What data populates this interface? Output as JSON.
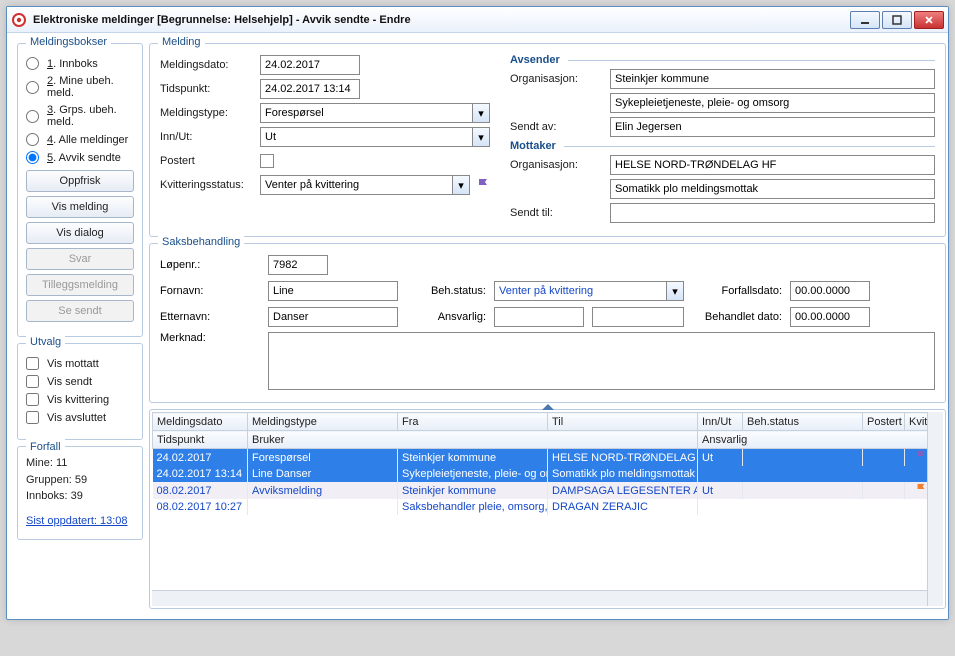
{
  "window": {
    "title": "Elektroniske meldinger  [Begrunnelse: Helsehjelp] - Avvik sendte - Endre"
  },
  "mailboxes": {
    "legend": "Meldingsbokser",
    "items": [
      {
        "num": "1",
        "label": "Innboks"
      },
      {
        "num": "2",
        "label": "Mine ubeh. meld."
      },
      {
        "num": "3",
        "label": "Grps. ubeh. meld."
      },
      {
        "num": "4",
        "label": "Alle meldinger"
      },
      {
        "num": "5",
        "label": "Avvik sendte"
      }
    ]
  },
  "buttons": {
    "oppfrisk": "Oppfrisk",
    "vis_melding": "Vis melding",
    "vis_dialog": "Vis dialog",
    "svar": "Svar",
    "tilleggsmelding": "Tilleggsmelding",
    "se_sendt": "Se sendt"
  },
  "utvalg": {
    "legend": "Utvalg",
    "vis_mottatt": "Vis mottatt",
    "vis_sendt": "Vis sendt",
    "vis_kvittering": "Vis kvittering",
    "vis_avsluttet": "Vis avsluttet"
  },
  "forfall": {
    "legend": "Forfall",
    "mine": "Mine: 11",
    "gruppen": "Gruppen: 59",
    "innboks": "Innboks: 39",
    "sist_oppdatert": "Sist oppdatert: 13:08"
  },
  "melding": {
    "legend": "Melding",
    "labels": {
      "meldingsdato": "Meldingsdato:",
      "tidspunkt": "Tidspunkt:",
      "meldingstype": "Meldingstype:",
      "innut": "Inn/Ut:",
      "postert": "Postert",
      "kvitteringsstatus": "Kvitteringsstatus:"
    },
    "meldingsdato": "24.02.2017",
    "tidspunkt": "24.02.2017 13:14",
    "meldingstype": "Forespørsel",
    "innut": "Ut",
    "kvitteringsstatus": "Venter på kvittering"
  },
  "avsender": {
    "legend": "Avsender",
    "labels": {
      "organisasjon": "Organisasjon:",
      "sendt_av": "Sendt av:"
    },
    "org1": "Steinkjer kommune",
    "org2": "Sykepleietjeneste, pleie- og omsorg",
    "sendt_av": "Elin Jegersen"
  },
  "mottaker": {
    "legend": "Mottaker",
    "labels": {
      "organisasjon": "Organisasjon:",
      "sendt_til": "Sendt til:"
    },
    "org1": "HELSE NORD-TRØNDELAG HF",
    "org2": "Somatikk plo meldingsmottak",
    "sendt_til": ""
  },
  "saks": {
    "legend": "Saksbehandling",
    "labels": {
      "lopenr": "Løpenr.:",
      "fornavn": "Fornavn:",
      "etternavn": "Etternavn:",
      "merknad": "Merknad:",
      "beh_status": "Beh.status:",
      "ansvarlig": "Ansvarlig:",
      "forfallsdato": "Forfallsdato:",
      "behandlet_dato": "Behandlet dato:"
    },
    "lopenr": "7982",
    "fornavn": "Line",
    "etternavn": "Danser",
    "beh_status": "Venter på kvittering",
    "ansvarlig1": "",
    "ansvarlig2": "",
    "forfallsdato": "00.00.0000",
    "behandlet_dato": "00.00.0000"
  },
  "table": {
    "headers1": {
      "meldingsdato": "Meldingsdato",
      "meldingstype": "Meldingstype",
      "fra": "Fra",
      "til": "Til",
      "innut": "Inn/Ut",
      "behstatus": "Beh.status",
      "postert": "Postert",
      "kvitt": "Kvitt."
    },
    "headers2": {
      "tidspunkt": "Tidspunkt",
      "bruker": "Bruker",
      "ansvarlig": "Ansvarlig"
    },
    "rows": [
      {
        "sel": true,
        "r1": {
          "dato": "24.02.2017",
          "type": "Forespørsel",
          "fra": "Steinkjer kommune",
          "til": "HELSE NORD-TRØNDELAG",
          "innut": "Ut",
          "beh": "",
          "post": "",
          "kvflag": "purple"
        },
        "r2": {
          "tid": "24.02.2017 13:14",
          "bruker": "Line Danser",
          "fra2": "Sykepleietjeneste, pleie- og oms",
          "til2": "Somatikk plo meldingsmottak",
          "ansvarlig": ""
        }
      },
      {
        "sel": false,
        "r1": {
          "dato": "08.02.2017",
          "type": "Avviksmelding",
          "fra": "Steinkjer kommune",
          "til": "DAMPSAGA LEGESENTER A",
          "innut": "Ut",
          "beh": "",
          "post": "",
          "kvflag": "orange"
        },
        "r2": {
          "tid": "08.02.2017 10:27",
          "bruker": "",
          "fra2": "Saksbehandler pleie, omsorg, r",
          "til2": "DRAGAN ZERAJIC",
          "ansvarlig": ""
        }
      }
    ]
  }
}
